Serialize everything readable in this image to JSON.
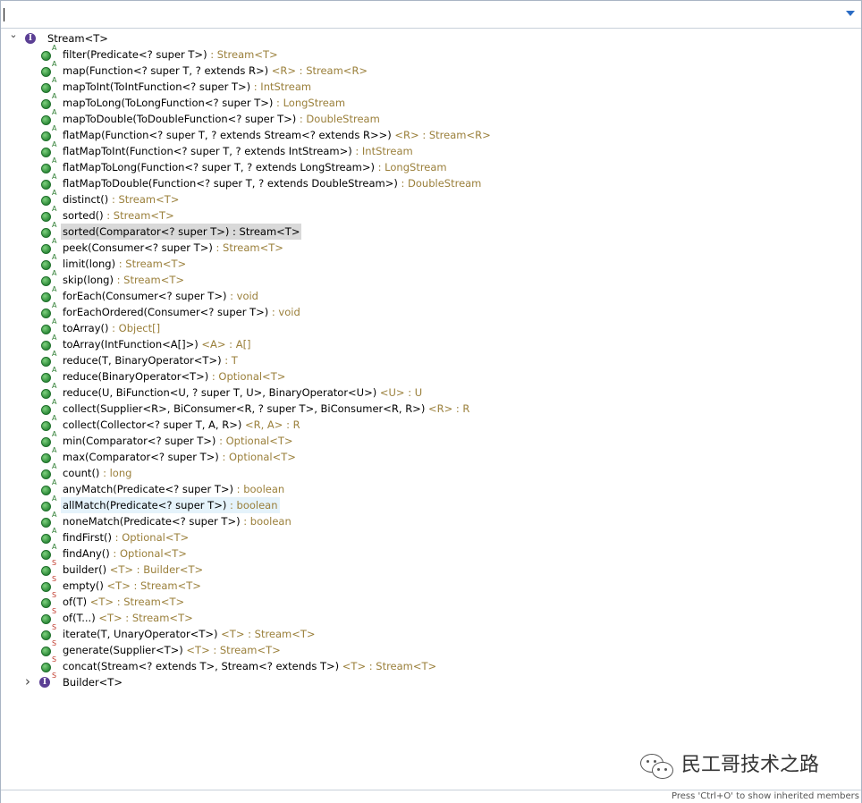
{
  "filter": {
    "value": "",
    "placeholder": ""
  },
  "root": {
    "label": "Stream<T>"
  },
  "members": [
    {
      "mod": "A",
      "sig": "filter(Predicate<? super T>)",
      "ret": " : Stream<T>"
    },
    {
      "mod": "A",
      "sig": "map(Function<? super T, ? extends R>)",
      "ret": " <R> : Stream<R>"
    },
    {
      "mod": "A",
      "sig": "mapToInt(ToIntFunction<? super T>)",
      "ret": " : IntStream"
    },
    {
      "mod": "A",
      "sig": "mapToLong(ToLongFunction<? super T>)",
      "ret": " : LongStream"
    },
    {
      "mod": "A",
      "sig": "mapToDouble(ToDoubleFunction<? super T>)",
      "ret": " : DoubleStream"
    },
    {
      "mod": "A",
      "sig": "flatMap(Function<? super T, ? extends Stream<? extends R>>)",
      "ret": " <R> : Stream<R>"
    },
    {
      "mod": "A",
      "sig": "flatMapToInt(Function<? super T, ? extends IntStream>)",
      "ret": " : IntStream"
    },
    {
      "mod": "A",
      "sig": "flatMapToLong(Function<? super T, ? extends LongStream>)",
      "ret": " : LongStream"
    },
    {
      "mod": "A",
      "sig": "flatMapToDouble(Function<? super T, ? extends DoubleStream>)",
      "ret": " : DoubleStream"
    },
    {
      "mod": "A",
      "sig": "distinct()",
      "ret": " : Stream<T>"
    },
    {
      "mod": "A",
      "sig": "sorted()",
      "ret": " : Stream<T>"
    },
    {
      "mod": "A",
      "sig": "sorted(Comparator<? super T>)",
      "ret": " : Stream<T>",
      "state": "selected"
    },
    {
      "mod": "A",
      "sig": "peek(Consumer<? super T>)",
      "ret": " : Stream<T>"
    },
    {
      "mod": "A",
      "sig": "limit(long)",
      "ret": " : Stream<T>"
    },
    {
      "mod": "A",
      "sig": "skip(long)",
      "ret": " : Stream<T>"
    },
    {
      "mod": "A",
      "sig": "forEach(Consumer<? super T>)",
      "ret": " : void"
    },
    {
      "mod": "A",
      "sig": "forEachOrdered(Consumer<? super T>)",
      "ret": " : void"
    },
    {
      "mod": "A",
      "sig": "toArray()",
      "ret": " : Object[]"
    },
    {
      "mod": "A",
      "sig": "toArray(IntFunction<A[]>)",
      "ret": " <A> : A[]"
    },
    {
      "mod": "A",
      "sig": "reduce(T, BinaryOperator<T>)",
      "ret": " : T"
    },
    {
      "mod": "A",
      "sig": "reduce(BinaryOperator<T>)",
      "ret": " : Optional<T>"
    },
    {
      "mod": "A",
      "sig": "reduce(U, BiFunction<U, ? super T, U>, BinaryOperator<U>)",
      "ret": " <U> : U"
    },
    {
      "mod": "A",
      "sig": "collect(Supplier<R>, BiConsumer<R, ? super T>, BiConsumer<R, R>)",
      "ret": " <R> : R"
    },
    {
      "mod": "A",
      "sig": "collect(Collector<? super T, A, R>)",
      "ret": " <R, A> : R"
    },
    {
      "mod": "A",
      "sig": "min(Comparator<? super T>)",
      "ret": " : Optional<T>"
    },
    {
      "mod": "A",
      "sig": "max(Comparator<? super T>)",
      "ret": " : Optional<T>"
    },
    {
      "mod": "A",
      "sig": "count()",
      "ret": " : long"
    },
    {
      "mod": "A",
      "sig": "anyMatch(Predicate<? super T>)",
      "ret": " : boolean"
    },
    {
      "mod": "A",
      "sig": "allMatch(Predicate<? super T>)",
      "ret": " : boolean",
      "state": "hover"
    },
    {
      "mod": "A",
      "sig": "noneMatch(Predicate<? super T>)",
      "ret": " : boolean"
    },
    {
      "mod": "A",
      "sig": "findFirst()",
      "ret": " : Optional<T>"
    },
    {
      "mod": "A",
      "sig": "findAny()",
      "ret": " : Optional<T>"
    },
    {
      "mod": "S",
      "sig": "builder()",
      "ret": " <T> : Builder<T>"
    },
    {
      "mod": "S",
      "sig": "empty()",
      "ret": " <T> : Stream<T>"
    },
    {
      "mod": "S",
      "sig": "of(T)",
      "ret": " <T> : Stream<T>"
    },
    {
      "mod": "S",
      "sig": "of(T...)",
      "ret": " <T> : Stream<T>"
    },
    {
      "mod": "S",
      "sig": "iterate(T, UnaryOperator<T>)",
      "ret": " <T> : Stream<T>"
    },
    {
      "mod": "S",
      "sig": "generate(Supplier<T>)",
      "ret": " <T> : Stream<T>"
    },
    {
      "mod": "S",
      "sig": "concat(Stream<? extends T>, Stream<? extends T>)",
      "ret": " <T> : Stream<T>"
    }
  ],
  "nested": {
    "mod": "S",
    "label": "Builder<T>"
  },
  "status": {
    "text": "Press 'Ctrl+O' to show inherited members"
  },
  "watermark": {
    "text": "民工哥技术之路"
  }
}
